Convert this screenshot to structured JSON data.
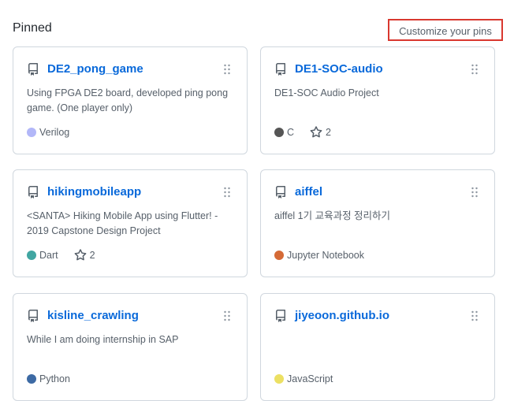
{
  "header": {
    "title": "Pinned",
    "customize_label": "Customize your pins"
  },
  "cards": [
    {
      "name": "DE2_pong_game",
      "description": "Using FPGA DE2 board, developed ping pong game. (One player only)",
      "language": "Verilog",
      "language_color": "#b2b7f8",
      "stars": ""
    },
    {
      "name": "DE1-SOC-audio",
      "description": "DE1-SOC Audio Project",
      "language": "C",
      "language_color": "#555555",
      "stars": "2"
    },
    {
      "name": "hikingmobileapp",
      "description": "<SANTA> Hiking Mobile App using Flutter! - 2019 Capstone Design Project",
      "language": "Dart",
      "language_color": "#41a6a2",
      "stars": "2"
    },
    {
      "name": "aiffel",
      "description": "aiffel 1기 교육과정 정리하기",
      "language": "Jupyter Notebook",
      "language_color": "#d56a36",
      "stars": ""
    },
    {
      "name": "kisline_crawling",
      "description": "While I am doing internship in SAP",
      "language": "Python",
      "language_color": "#3d6aa4",
      "stars": ""
    },
    {
      "name": "jiyeoon.github.io",
      "description": "",
      "language": "JavaScript",
      "language_color": "#ece063",
      "stars": ""
    }
  ],
  "icons": {
    "repo": "repo-icon",
    "drag": "grabber-icon",
    "star": "star-icon"
  }
}
